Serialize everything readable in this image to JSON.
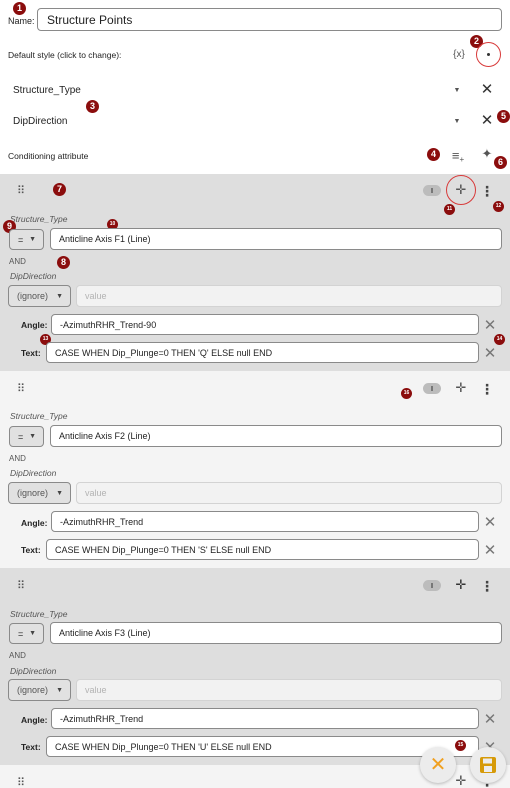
{
  "header": {
    "name_label": "Name:",
    "name_value": "Structure Points",
    "default_style_label": "Default style (click to change):",
    "style_expr_icon": "{x}"
  },
  "attributes": [
    {
      "name": "Structure_Type"
    },
    {
      "name": "DipDirection"
    }
  ],
  "conditioning_label": "Conditioning attribute",
  "rule_labels": {
    "angle": "Angle:",
    "text": "Text:",
    "and": "AND",
    "placeholder_value": "value"
  },
  "rules": [
    {
      "attr1": "Structure_Type",
      "op1": "=",
      "value1": "Anticline Axis F1 (Line)",
      "attr2": "DipDirection",
      "op2": "(ignore)",
      "angle": "-AzimuthRHR_Trend-90",
      "text": "CASE WHEN Dip_Plunge=0 THEN 'Q' ELSE null END"
    },
    {
      "attr1": "Structure_Type",
      "op1": "=",
      "value1": "Anticline Axis F2 (Line)",
      "attr2": "DipDirection",
      "op2": "(ignore)",
      "angle": "-AzimuthRHR_Trend",
      "text": "CASE WHEN Dip_Plunge=0 THEN 'S' ELSE null END"
    },
    {
      "attr1": "Structure_Type",
      "op1": "=",
      "value1": "Anticline Axis F3 (Line)",
      "attr2": "DipDirection",
      "op2": "(ignore)",
      "angle": "-AzimuthRHR_Trend",
      "text": "CASE WHEN Dip_Plunge=0 THEN 'U' ELSE null END"
    }
  ],
  "markers": [
    "1",
    "2",
    "3",
    "4",
    "5",
    "6",
    "7",
    "8",
    "9",
    "10",
    "11",
    "12",
    "13",
    "14",
    "15",
    "16"
  ],
  "colors": {
    "marker": "#8b0d0d",
    "highlight": "#d83a3a",
    "cancel_fab": "#f0a020",
    "save_fab": "#d69a08"
  }
}
